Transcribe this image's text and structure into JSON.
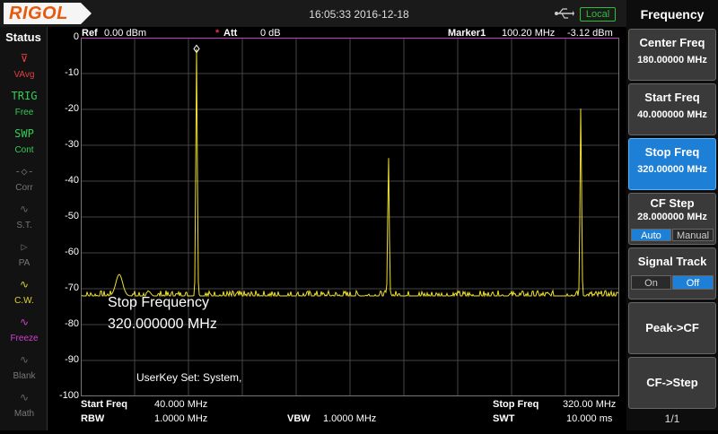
{
  "brand": {
    "logo": "RIGOL"
  },
  "topbar": {
    "datetime": "16:05:33 2016-12-18",
    "local_label": "Local"
  },
  "status": {
    "title": "Status",
    "items": [
      {
        "top": "⊽",
        "label": "VAvg",
        "color": "#e04040"
      },
      {
        "top": "TRIG",
        "label": "Free",
        "color": "#33cc55"
      },
      {
        "top": "SWP",
        "label": "Cont",
        "color": "#33cc55"
      },
      {
        "top": "-◇-",
        "label": "Corr",
        "color": "#666666"
      },
      {
        "top": "∿",
        "label": "S.T.",
        "color": "#666666"
      },
      {
        "top": "▷",
        "label": "PA",
        "color": "#666666"
      },
      {
        "top": "∿",
        "label": "C.W.",
        "color": "#e0d030"
      },
      {
        "top": "∿",
        "label": "Freeze",
        "color": "#d040d0"
      },
      {
        "top": "∿",
        "label": "Blank",
        "color": "#666666"
      },
      {
        "top": "∿",
        "label": "Math",
        "color": "#666666"
      }
    ]
  },
  "header": {
    "ref_label": "Ref",
    "ref_value": "0.00 dBm",
    "att_star": "*",
    "att_label": "Att",
    "att_value": "0 dB",
    "marker_label": "Marker1",
    "marker_freq": "100.20 MHz",
    "marker_amp": "-3.12 dBm"
  },
  "y_ticks": [
    "0",
    "-10",
    "-20",
    "-30",
    "-40",
    "-50",
    "-60",
    "-70",
    "-80",
    "-90",
    "-100"
  ],
  "overlay": {
    "line1": "Stop Frequency",
    "line2": "320.000000 MHz",
    "userkey": "UserKey Set:    System,"
  },
  "bottom": {
    "start_label": "Start Freq",
    "start_value": "40.000 MHz",
    "rbw_label": "RBW",
    "rbw_value": "1.0000 MHz",
    "vbw_label": "VBW",
    "vbw_value": "1.0000 MHz",
    "stop_label": "Stop Freq",
    "stop_value": "320.00 MHz",
    "swt_label": "SWT",
    "swt_value": "10.000 ms"
  },
  "menu": {
    "title": "Frequency",
    "center_freq": {
      "label": "Center Freq",
      "value": "180.00000 MHz"
    },
    "start_freq": {
      "label": "Start Freq",
      "value": "40.000000 MHz"
    },
    "stop_freq": {
      "label": "Stop Freq",
      "value": "320.00000 MHz"
    },
    "cf_step": {
      "label": "CF Step",
      "value": "28.000000 MHz",
      "opt_auto": "Auto",
      "opt_manual": "Manual"
    },
    "signal_track": {
      "label": "Signal Track",
      "opt_on": "On",
      "opt_off": "Off"
    },
    "peak_cf": {
      "label": "Peak->CF"
    },
    "cf_step_key": {
      "label": "CF->Step"
    },
    "page": "1/1"
  },
  "chart_data": {
    "type": "line",
    "xlabel": "",
    "ylabel": "",
    "xlim": [
      40,
      320
    ],
    "ylim": [
      -100,
      0
    ],
    "units_x": "MHz",
    "units_y": "dBm",
    "noise_floor": -72,
    "peaks": [
      {
        "freq": 60.0,
        "amp": -66
      },
      {
        "freq": 100.2,
        "amp": -3.12
      },
      {
        "freq": 200.0,
        "amp": -33
      },
      {
        "freq": 300.0,
        "amp": -19
      }
    ],
    "trace_color": "#f0e030",
    "grid": true
  }
}
